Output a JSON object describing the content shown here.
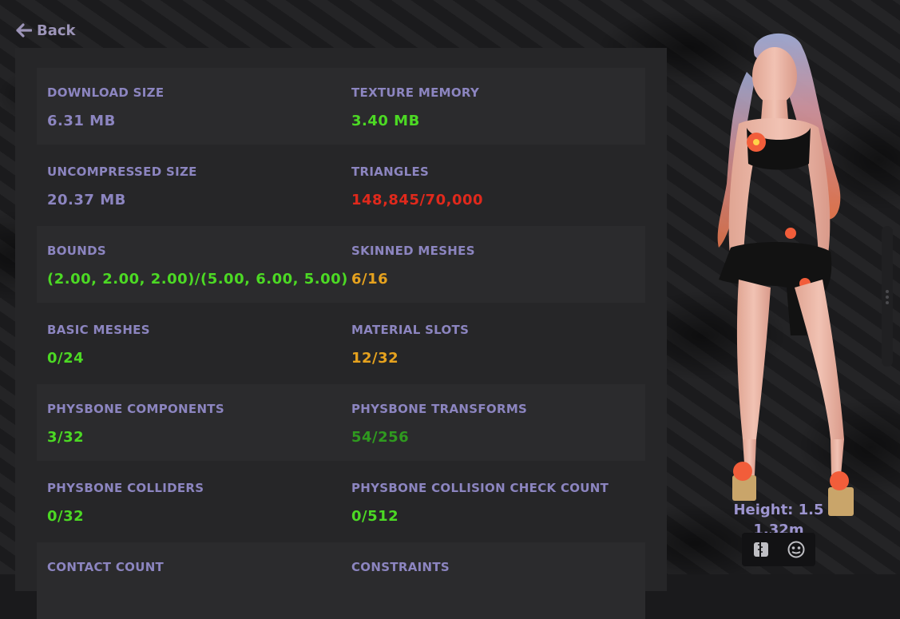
{
  "nav": {
    "back_label": "Back"
  },
  "colors": {
    "label": "#8c85c0",
    "neutral": "#8c85c0",
    "good": "#4cd924",
    "ok": "#2f9a1f",
    "warning": "#e6a21e",
    "bad": "#e0291c"
  },
  "stats": [
    {
      "left": {
        "label": "DOWNLOAD SIZE",
        "value": "6.31 MB",
        "status": "neutral"
      },
      "right": {
        "label": "TEXTURE MEMORY",
        "value": "3.40 MB",
        "status": "good"
      }
    },
    {
      "left": {
        "label": "UNCOMPRESSED SIZE",
        "value": "20.37 MB",
        "status": "neutral"
      },
      "right": {
        "label": "TRIANGLES",
        "value": "148,845/70,000",
        "status": "bad"
      }
    },
    {
      "left": {
        "label": "BOUNDS",
        "value": "(2.00, 2.00, 2.00)/(5.00, 6.00, 5.00)",
        "status": "good"
      },
      "right": {
        "label": "SKINNED MESHES",
        "value": "6/16",
        "status": "warning"
      }
    },
    {
      "left": {
        "label": "BASIC MESHES",
        "value": "0/24",
        "status": "good"
      },
      "right": {
        "label": "MATERIAL SLOTS",
        "value": "12/32",
        "status": "warning"
      }
    },
    {
      "left": {
        "label": "PHYSBONE COMPONENTS",
        "value": "3/32",
        "status": "good"
      },
      "right": {
        "label": "PHYSBONE TRANSFORMS",
        "value": "54/256",
        "status": "ok"
      }
    },
    {
      "left": {
        "label": "PHYSBONE COLLIDERS",
        "value": "0/32",
        "status": "good"
      },
      "right": {
        "label": "PHYSBONE COLLISION CHECK COUNT",
        "value": "0/512",
        "status": "good"
      }
    },
    {
      "left": {
        "label": "CONTACT COUNT",
        "value": "",
        "status": "good"
      },
      "right": {
        "label": "CONSTRAINTS",
        "value": "",
        "status": "good"
      }
    }
  ],
  "avatar_preview": {
    "height_line1": "Height: 1.5",
    "height_line2": "1.32m",
    "icons": [
      "zipper-bag-icon",
      "face-mask-icon"
    ]
  }
}
